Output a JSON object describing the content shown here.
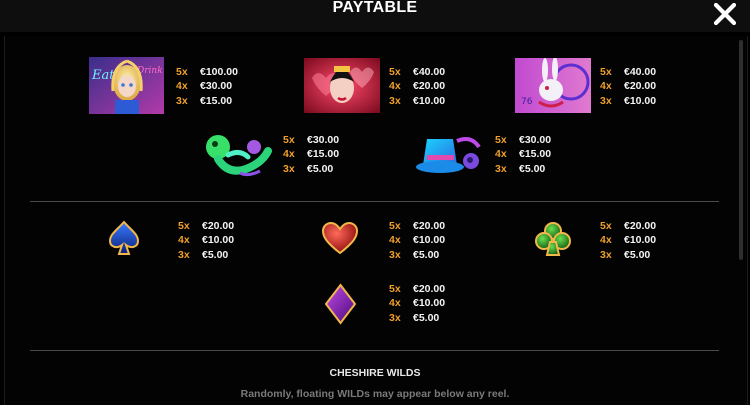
{
  "header": {
    "title": "PAYTABLE",
    "close_icon": "close-icon"
  },
  "premium_symbols": [
    {
      "symbol": "alice",
      "pays": [
        {
          "mult": "5x",
          "value": "€100.00"
        },
        {
          "mult": "4x",
          "value": "€30.00"
        },
        {
          "mult": "3x",
          "value": "€15.00"
        }
      ]
    },
    {
      "symbol": "queen-of-hearts",
      "pays": [
        {
          "mult": "5x",
          "value": "€40.00"
        },
        {
          "mult": "4x",
          "value": "€20.00"
        },
        {
          "mult": "3x",
          "value": "€10.00"
        }
      ]
    },
    {
      "symbol": "white-rabbit",
      "pays": [
        {
          "mult": "5x",
          "value": "€40.00"
        },
        {
          "mult": "4x",
          "value": "€20.00"
        },
        {
          "mult": "3x",
          "value": "€10.00"
        }
      ]
    },
    {
      "symbol": "caterpillar",
      "pays": [
        {
          "mult": "5x",
          "value": "€30.00"
        },
        {
          "mult": "4x",
          "value": "€15.00"
        },
        {
          "mult": "3x",
          "value": "€5.00"
        }
      ]
    },
    {
      "symbol": "mad-hatter-hat",
      "pays": [
        {
          "mult": "5x",
          "value": "€30.00"
        },
        {
          "mult": "4x",
          "value": "€15.00"
        },
        {
          "mult": "3x",
          "value": "€5.00"
        }
      ]
    }
  ],
  "card_symbols": [
    {
      "symbol": "spade",
      "pays": [
        {
          "mult": "5x",
          "value": "€20.00"
        },
        {
          "mult": "4x",
          "value": "€10.00"
        },
        {
          "mult": "3x",
          "value": "€5.00"
        }
      ]
    },
    {
      "symbol": "heart",
      "pays": [
        {
          "mult": "5x",
          "value": "€20.00"
        },
        {
          "mult": "4x",
          "value": "€10.00"
        },
        {
          "mult": "3x",
          "value": "€5.00"
        }
      ]
    },
    {
      "symbol": "club",
      "pays": [
        {
          "mult": "5x",
          "value": "€20.00"
        },
        {
          "mult": "4x",
          "value": "€10.00"
        },
        {
          "mult": "3x",
          "value": "€5.00"
        }
      ]
    },
    {
      "symbol": "diamond",
      "pays": [
        {
          "mult": "5x",
          "value": "€20.00"
        },
        {
          "mult": "4x",
          "value": "€10.00"
        },
        {
          "mult": "3x",
          "value": "€5.00"
        }
      ]
    }
  ],
  "alice_art_text": {
    "left": "Eat Me",
    "right": "Drink Me"
  },
  "wilds_section": {
    "title": "CHESHIRE WILDS",
    "description": "Randomly, floating WILDs may appear below any reel."
  },
  "colors": {
    "multiplier": "#f0a02c",
    "value": "#f4f4f4",
    "background": "#000000",
    "divider": "#4a4a4a"
  }
}
